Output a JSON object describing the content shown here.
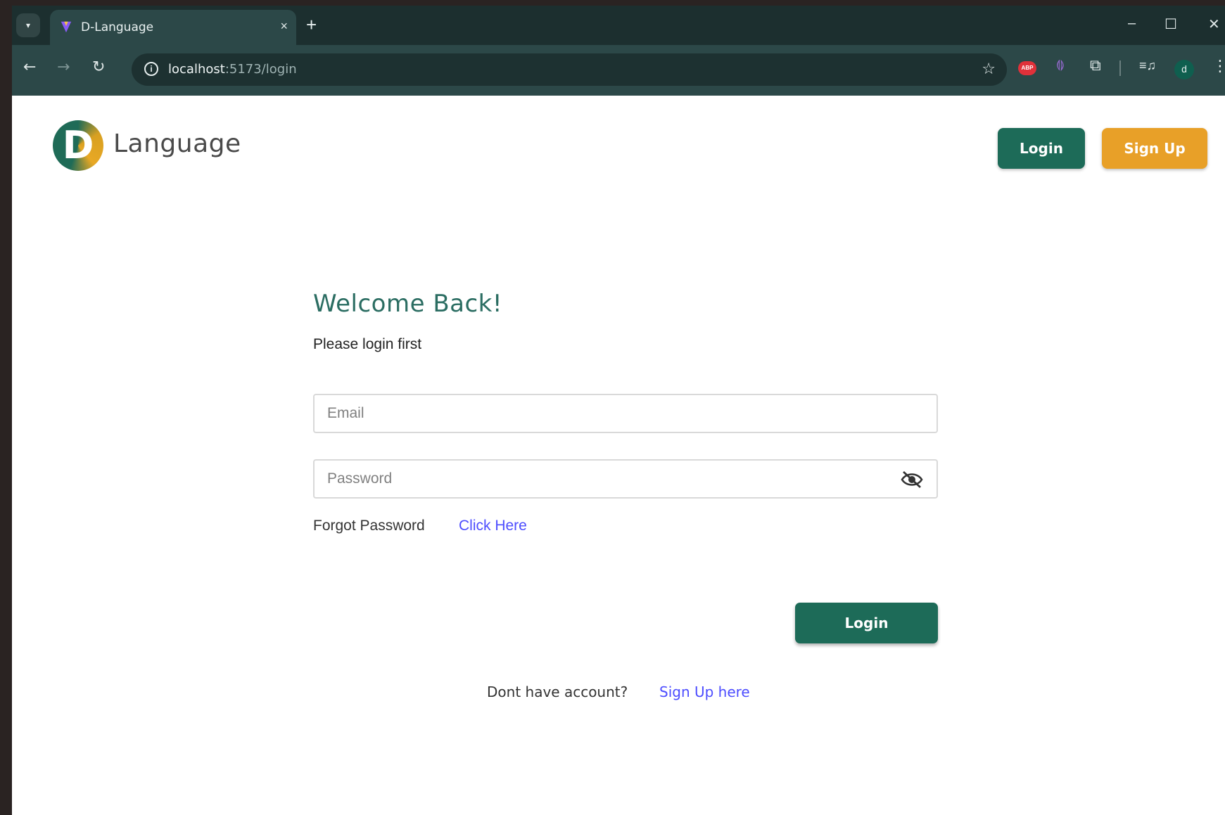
{
  "browser": {
    "tab_title": "D-Language",
    "new_tab": "+",
    "tab_close": "×",
    "url_host": "localhost",
    "url_path": ":5173/login",
    "profile_initial": "d",
    "window_controls": {
      "minimize": "–",
      "maximize": "☐",
      "close": "✕"
    },
    "extension_badge": "ABP",
    "icons": [
      "tab-search-icon",
      "close-icon",
      "plus-icon",
      "back-arrow-icon",
      "forward-arrow-icon",
      "reload-icon",
      "site-info-icon",
      "star-icon",
      "adblock-icon",
      "extension-icon",
      "puzzle-icon",
      "media-icon",
      "kebab-menu-icon"
    ]
  },
  "header": {
    "logo_letter": "D",
    "brand": "Language",
    "login_label": "Login",
    "signup_label": "Sign Up"
  },
  "login_form": {
    "title": "Welcome Back!",
    "subtitle": "Please login first",
    "email_placeholder": "Email",
    "password_placeholder": "Password",
    "forgot_text": "Forgot Password",
    "forgot_link": "Click Here",
    "submit_label": "Login",
    "no_account_text": "Dont have account?",
    "signup_link": "Sign Up here"
  },
  "colors": {
    "primary": "#1d6b58",
    "accent": "#e8a028",
    "link": "#4d4dff",
    "title": "#2b6d62"
  }
}
